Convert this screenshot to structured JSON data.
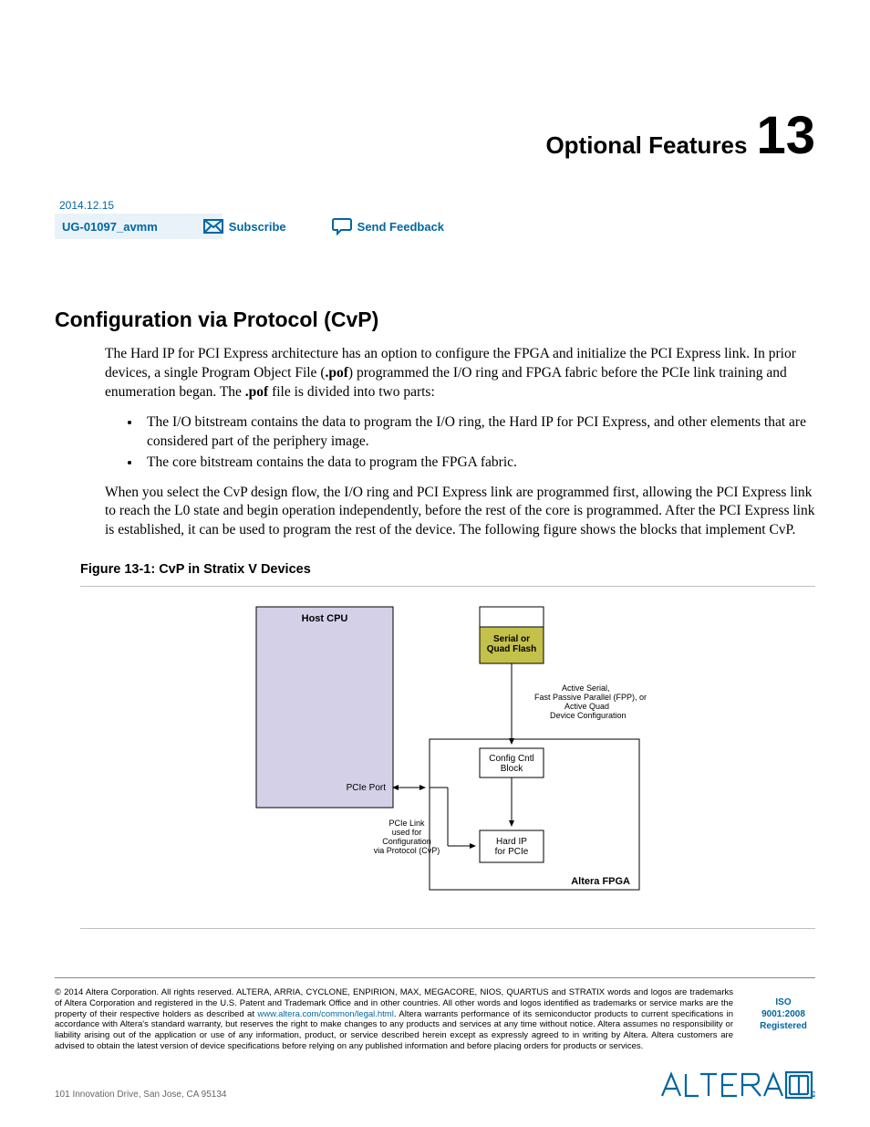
{
  "chapter": {
    "title": "Optional Features",
    "number": "13"
  },
  "meta": {
    "date": "2014.12.15",
    "doc_id": "UG-01097_avmm",
    "subscribe": "Subscribe",
    "feedback": "Send Feedback"
  },
  "section": {
    "title": "Configuration via Protocol (CvP)"
  },
  "para1_a": "The Hard IP for PCI Express architecture has an option to configure the FPGA and initialize the PCI Express link. In prior devices, a single Program Object File (",
  "para1_b": ".pof",
  "para1_c": ") programmed the I/O ring and FPGA fabric before the PCIe link training and enumeration began. The ",
  "para1_d": ".pof",
  "para1_e": " file is divided into two parts:",
  "bullets": [
    "The I/O bitstream contains the data to program the I/O ring, the Hard IP for PCI Express, and other elements that are considered part of the periphery image.",
    "The core bitstream contains the data to program the FPGA fabric."
  ],
  "para2": "When you select the CvP design flow, the I/O ring and PCI Express link are programmed first, allowing the PCI Express link to reach the L0 state and begin operation independently, before the rest of the core is programmed. After the PCI Express link is established, it can be used to program the rest of the device. The following figure shows the blocks that implement CvP.",
  "figure": {
    "caption": "Figure 13-1: CvP in Stratix V Devices"
  },
  "diagram": {
    "host_cpu": "Host CPU",
    "flash": "Serial or\nQuad Flash",
    "flash_note": "Active Serial,\nFast Passive Parallel (FPP), or\nActive Quad\nDevice Configuration",
    "config_block": "Config Cntl\nBlock",
    "pcie_port": "PCIe Port",
    "pcie_note": "PCIe Link\nused for\nConfiguration\nvia Protocol (CvP)",
    "hard_ip": "Hard IP\nfor  PCIe",
    "fpga_label": "Altera FPGA"
  },
  "footer": {
    "copyright_sym": "©",
    "legal_a": " 2014 Altera Corporation. All rights reserved. ALTERA, ARRIA, CYCLONE, ENPIRION, MAX, MEGACORE, NIOS, QUARTUS and STRATIX words and logos are trademarks of Altera Corporation and registered in the U.S. Patent and Trademark Office and in other countries. All other words and logos identified as trademarks or service marks are the property of their respective holders as described at ",
    "legal_link": "www.altera.com/common/legal.html",
    "legal_b": ". Altera warrants performance of its semiconductor products to current specifications in accordance with Altera's standard warranty, but reserves the right to make changes to any products and services at any time without notice. Altera assumes no responsibility or liability arising out of the application or use of any information, product, or service described herein except as expressly agreed to in writing by Altera. Altera customers are advised to obtain the latest version of device specifications before relying on any published information and before placing orders for products or services.",
    "iso_l1": "ISO",
    "iso_l2": "9001:2008",
    "iso_l3": "Registered",
    "address": "101 Innovation Drive, San Jose, CA 95134"
  }
}
